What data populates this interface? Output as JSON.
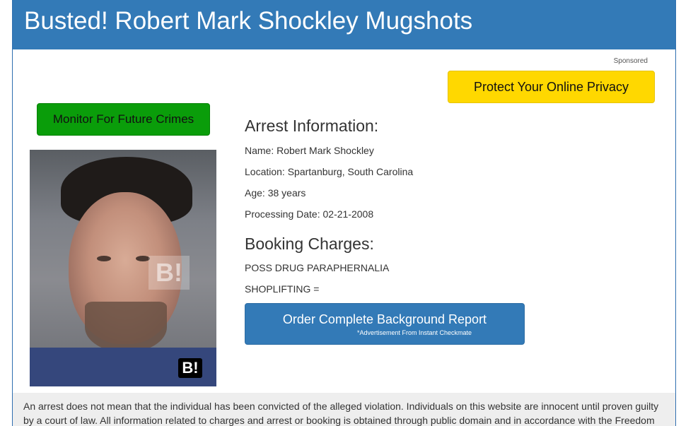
{
  "header": {
    "title": "Busted! Robert Mark Shockley Mugshots"
  },
  "ads": {
    "sponsored_label": "Sponsored",
    "privacy_button": "Protect Your Online Privacy",
    "monitor_button": "Monitor For Future Crimes",
    "order_button": "Order Complete Background Report",
    "order_note": "*Advertisement From Instant Checkmate"
  },
  "mugshot": {
    "watermark": "B!",
    "logo": "B!"
  },
  "arrest": {
    "heading": "Arrest Information:",
    "name": "Name: Robert Mark Shockley",
    "location": "Location: Spartanburg, South Carolina",
    "age": "Age: 38 years",
    "processing_date": "Processing Date: 02-21-2008"
  },
  "booking": {
    "heading": "Booking Charges:",
    "charges": [
      "POSS DRUG PARAPHERNALIA",
      "SHOPLIFTING ="
    ]
  },
  "disclaimer": "An arrest does not mean that the individual has been convicted of the alleged violation. Individuals on this website are innocent until proven guilty by a court of law. All information related to charges and arrest or booking is obtained through public domain and in accordance with the Freedom",
  "colors": {
    "header_bg": "#337ab7",
    "privacy_bg": "#ffd800",
    "monitor_bg": "#0a9d0a",
    "order_bg": "#337ab7"
  }
}
